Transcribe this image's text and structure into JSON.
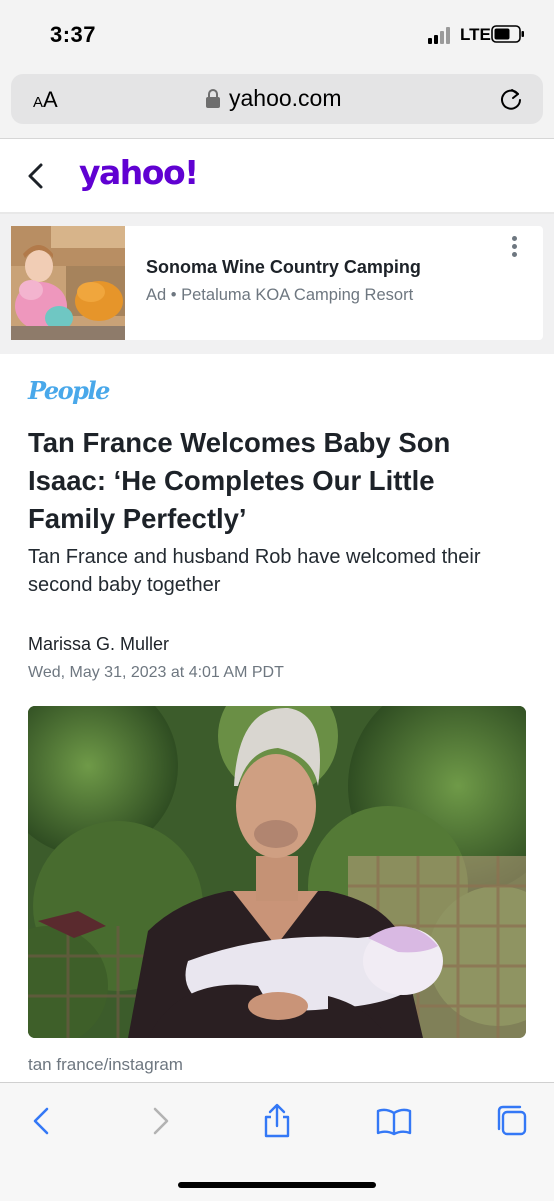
{
  "status_bar": {
    "time": "3:37",
    "network": "LTE"
  },
  "browser": {
    "text_size_label_small": "A",
    "text_size_label_large": "A",
    "domain": "yahoo.com"
  },
  "header": {
    "logo_text": "yahoo!"
  },
  "ad": {
    "title": "Sonoma Wine Country Camping",
    "subtitle": "Ad • Petaluma KOA Camping Resort"
  },
  "article": {
    "publisher": "People",
    "headline": "Tan France Welcomes Baby Son Isaac: ‘He Completes Our Little Family Perfectly’",
    "subheadline": "Tan France and husband Rob have welcomed their second baby together",
    "author": "Marissa G. Muller",
    "date": "Wed, May 31, 2023 at 4:01 AM PDT",
    "photo_credit": "tan france/instagram"
  },
  "colors": {
    "yahoo_purple": "#6001d2",
    "people_blue": "#49a8ea",
    "ios_blue": "#3478f6"
  },
  "icons": [
    "signal-icon",
    "battery-icon",
    "lock-icon",
    "reload-icon",
    "back-chevron-icon",
    "more-options-icon",
    "back-icon",
    "forward-icon",
    "share-icon",
    "bookmarks-icon",
    "tabs-icon"
  ]
}
